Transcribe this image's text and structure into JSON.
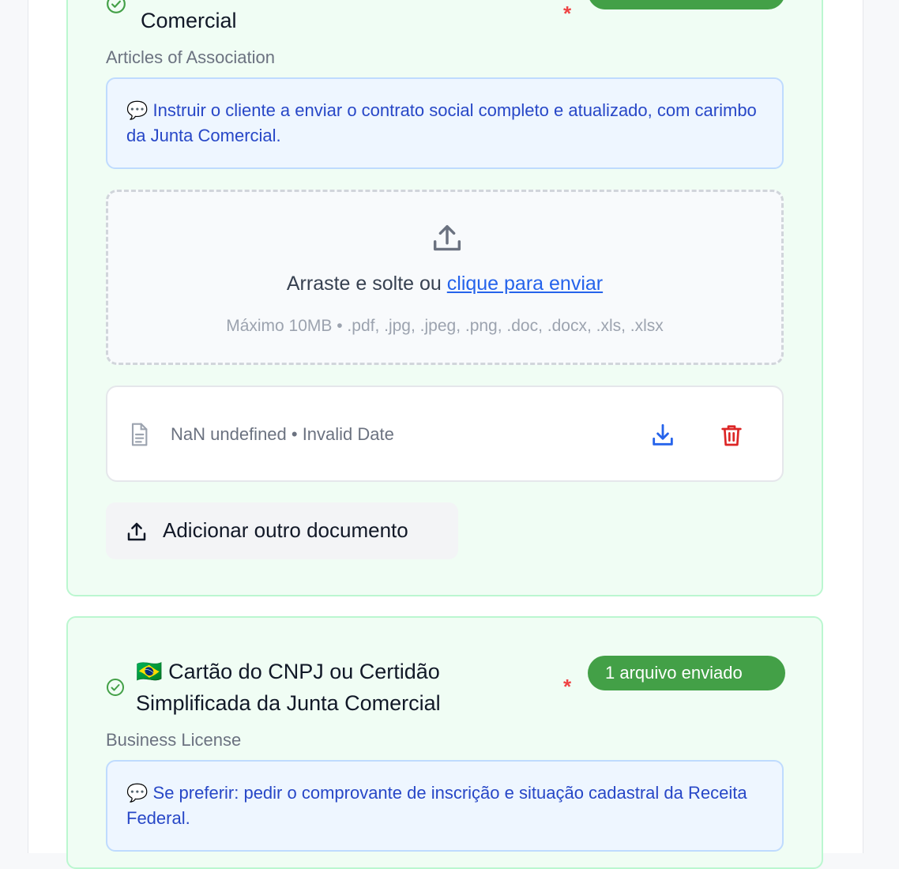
{
  "documents": [
    {
      "title_line1": "",
      "title_line2": "Comercial",
      "subtitle": "Articles of Association",
      "note": "Instruir o cliente a enviar o contrato social completo e atualizado, com carimbo da Junta Comercial.",
      "note_icon": "💬",
      "required_mark": "*",
      "status": "",
      "upload": {
        "icon": "upload-icon",
        "text_prefix": "Arraste e solte ou ",
        "link_text": "clique para enviar",
        "hint": "Máximo 10MB • .pdf, .jpg, .jpeg, .png, .doc, .docx, .xls, .xlsx"
      },
      "file": {
        "meta": "NaN undefined • Invalid Date",
        "icons": [
          "file-icon",
          "download-icon",
          "trash-icon"
        ]
      },
      "add_button_label": "Adicionar outro documento"
    },
    {
      "flag": "🇧🇷",
      "title_line1": "Cartão do CNPJ ou Certidão",
      "title_line2": "Simplificada da Junta Comercial",
      "subtitle": "Business License",
      "note_icon": "💬",
      "note": "Se preferir: pedir o comprovante de inscrição e situação cadastral da Receita Federal.",
      "required_mark": "*",
      "status": "1 arquivo enviado"
    }
  ],
  "colors": {
    "card_bg": "#f0fdf4",
    "card_border": "#bbf7d0",
    "status_green": "#43a047",
    "note_text": "#2747c7",
    "link_blue": "#2563eb",
    "delete_red": "#dc2626",
    "required_red": "#ef4444"
  }
}
